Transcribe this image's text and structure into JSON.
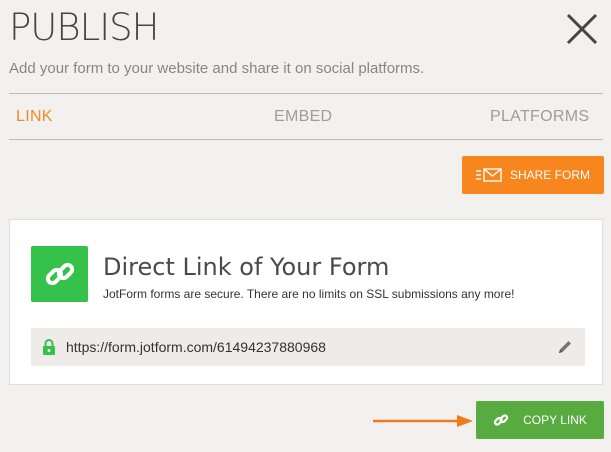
{
  "header": {
    "title": "PUBLISH",
    "subtitle": "Add your form to your website and share it on social platforms.",
    "close_icon": "close-icon"
  },
  "tabs": [
    {
      "label": "LINK",
      "active": true
    },
    {
      "label": "EMBED",
      "active": false
    },
    {
      "label": "PLATFORMS",
      "active": false
    }
  ],
  "share_button": {
    "label": "SHARE FORM",
    "icon": "envelope-icon",
    "color": "#f7861e"
  },
  "card": {
    "title": "Direct Link of Your Form",
    "description": "JotForm forms are secure. There are no limits on SSL submissions any more!",
    "icon": "chain-link-icon",
    "icon_bg": "#35c24b",
    "url": "https://form.jotform.com/61494237880968",
    "lock_icon": "padlock-icon",
    "edit_icon": "pencil-icon"
  },
  "copy_button": {
    "label": "COPY LINK",
    "icon": "chain-link-icon",
    "color": "#58ab3f"
  },
  "colors": {
    "accent": "#f08a2a",
    "background": "#f3f1ef"
  }
}
